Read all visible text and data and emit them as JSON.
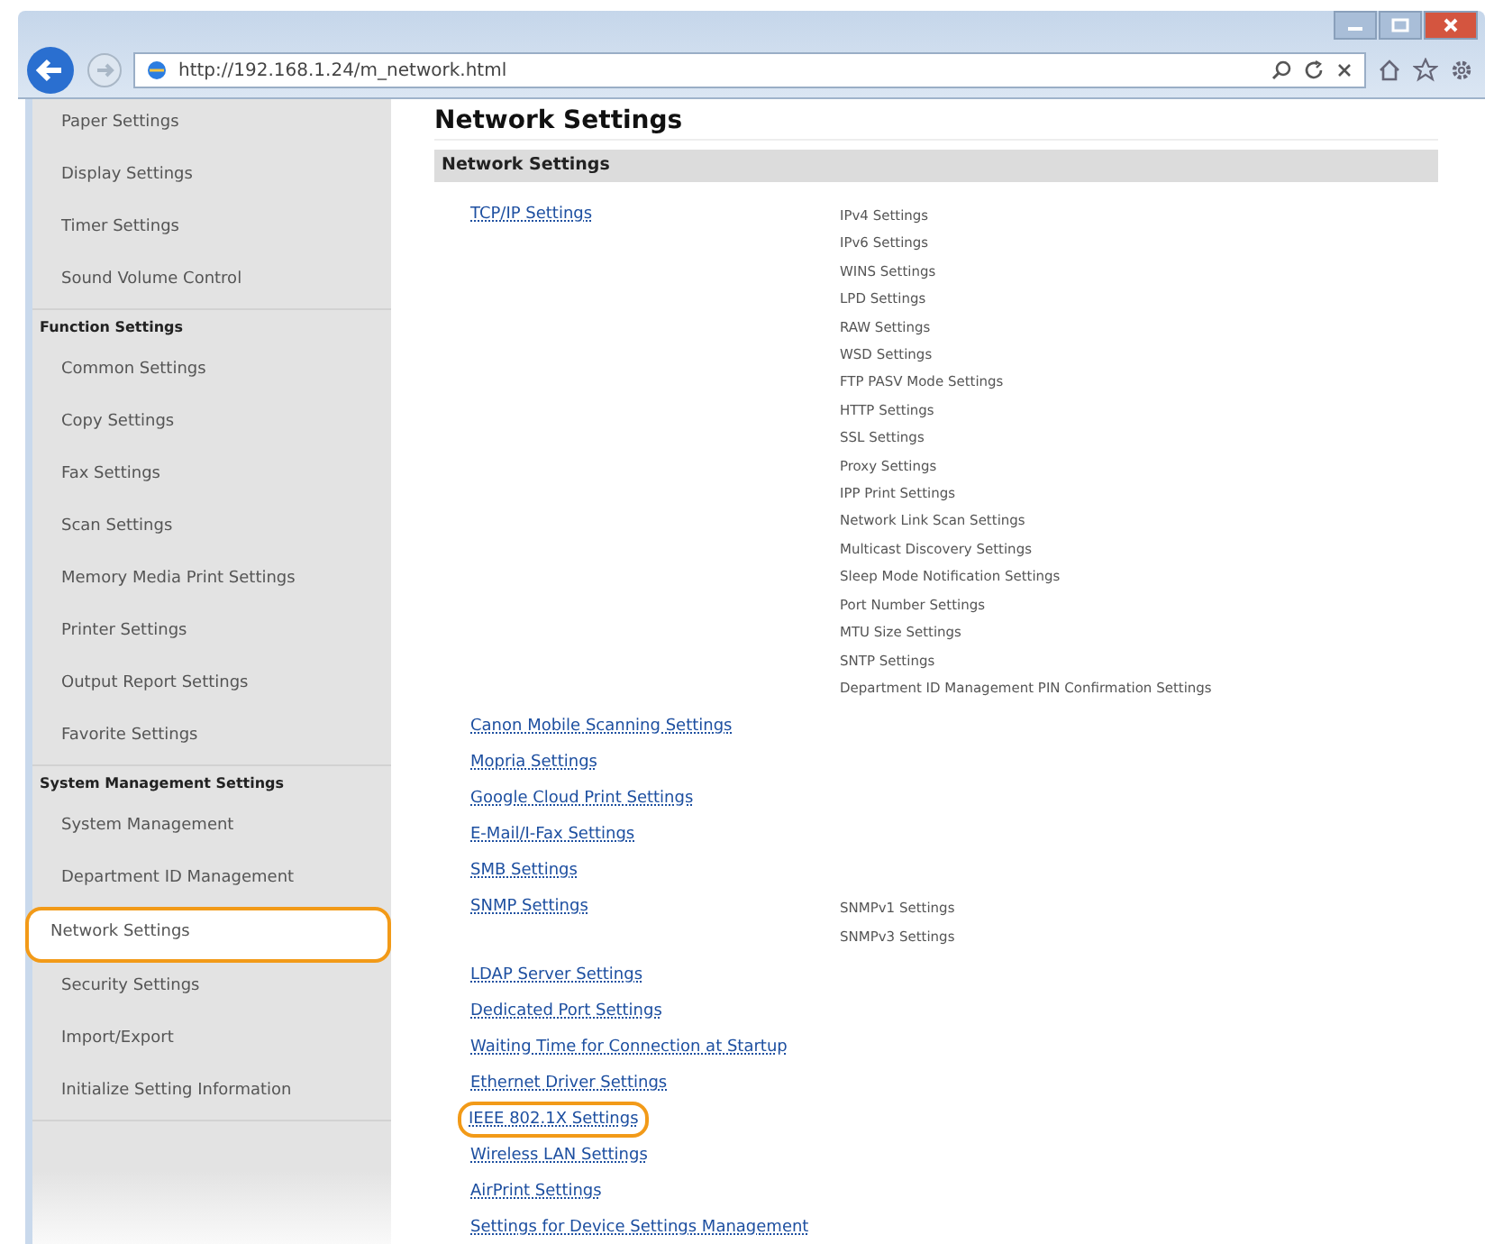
{
  "browser": {
    "url": "http://192.168.1.24/m_network.html"
  },
  "sidebar": {
    "items": [
      {
        "kind": "item",
        "label": "Paper Settings",
        "selected": false
      },
      {
        "kind": "item",
        "label": "Display Settings",
        "selected": false
      },
      {
        "kind": "item",
        "label": "Timer Settings",
        "selected": false
      },
      {
        "kind": "item",
        "label": "Sound Volume Control",
        "selected": false
      },
      {
        "kind": "header",
        "label": "Function Settings"
      },
      {
        "kind": "item",
        "label": "Common Settings",
        "selected": false
      },
      {
        "kind": "item",
        "label": "Copy Settings",
        "selected": false
      },
      {
        "kind": "item",
        "label": "Fax Settings",
        "selected": false
      },
      {
        "kind": "item",
        "label": "Scan Settings",
        "selected": false
      },
      {
        "kind": "item",
        "label": "Memory Media Print Settings",
        "selected": false
      },
      {
        "kind": "item",
        "label": "Printer Settings",
        "selected": false
      },
      {
        "kind": "item",
        "label": "Output Report Settings",
        "selected": false
      },
      {
        "kind": "item",
        "label": "Favorite Settings",
        "selected": false
      },
      {
        "kind": "header",
        "label": "System Management Settings"
      },
      {
        "kind": "item",
        "label": "System Management",
        "selected": false
      },
      {
        "kind": "item",
        "label": "Department ID Management",
        "selected": false
      },
      {
        "kind": "item",
        "label": "Network Settings",
        "selected": true
      },
      {
        "kind": "item",
        "label": "Security Settings",
        "selected": false
      },
      {
        "kind": "item",
        "label": "Import/Export",
        "selected": false
      },
      {
        "kind": "item",
        "label": "Initialize Setting Information",
        "selected": false
      }
    ]
  },
  "main": {
    "title": "Network Settings",
    "section": "Network Settings",
    "links": [
      {
        "label": "TCP/IP Settings",
        "highlighted": false,
        "sub_items": [
          "IPv4 Settings",
          "IPv6 Settings",
          "WINS Settings",
          "LPD Settings",
          "RAW Settings",
          "WSD Settings",
          "FTP PASV Mode Settings",
          "HTTP Settings",
          "SSL Settings",
          "Proxy Settings",
          "IPP Print Settings",
          "Network Link Scan Settings",
          "Multicast Discovery Settings",
          "Sleep Mode Notification Settings",
          "Port Number Settings",
          "MTU Size Settings",
          "SNTP Settings",
          "Department ID Management PIN Confirmation Settings"
        ]
      },
      {
        "label": "Canon Mobile Scanning Settings",
        "highlighted": false
      },
      {
        "label": "Mopria Settings",
        "highlighted": false
      },
      {
        "label": "Google Cloud Print Settings",
        "highlighted": false
      },
      {
        "label": "E-Mail/I-Fax Settings",
        "highlighted": false
      },
      {
        "label": "SMB Settings",
        "highlighted": false
      },
      {
        "label": "SNMP Settings",
        "highlighted": false,
        "sub_items": [
          "SNMPv1 Settings",
          "SNMPv3 Settings"
        ]
      },
      {
        "label": "LDAP Server Settings",
        "highlighted": false
      },
      {
        "label": "Dedicated Port Settings",
        "highlighted": false
      },
      {
        "label": "Waiting Time for Connection at Startup",
        "highlighted": false
      },
      {
        "label": "Ethernet Driver Settings",
        "highlighted": false
      },
      {
        "label": "IEEE 802.1X Settings",
        "highlighted": true
      },
      {
        "label": "Wireless LAN Settings",
        "highlighted": false
      },
      {
        "label": "AirPrint Settings",
        "highlighted": false
      },
      {
        "label": "Settings for Device Settings Management",
        "highlighted": false
      }
    ]
  }
}
